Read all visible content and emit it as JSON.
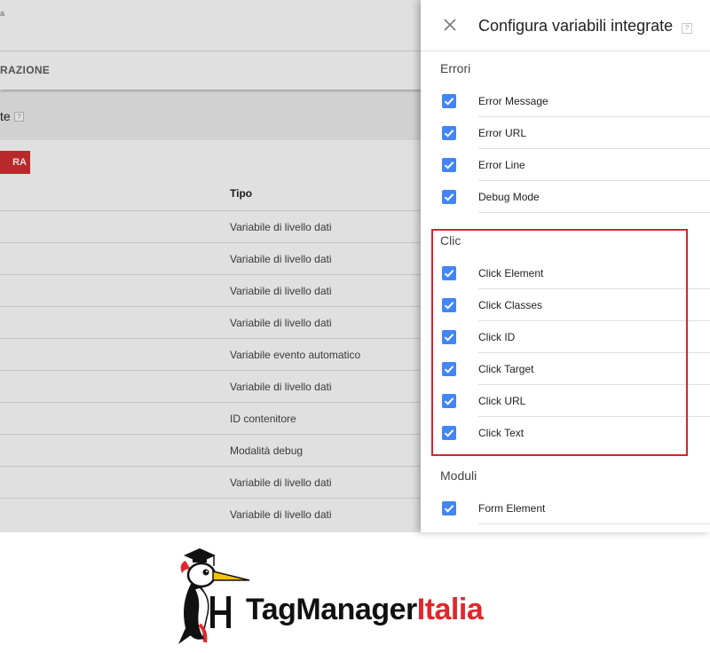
{
  "background_app": {
    "breadcrumb": "a",
    "tab_label": "RAZIONE",
    "section_title": "te",
    "section_help": "?",
    "new_button_label": "RA",
    "type_column_header": "Tipo",
    "rows": [
      {
        "type": "Variabile di livello dati"
      },
      {
        "type": "Variabile di livello dati"
      },
      {
        "type": "Variabile di livello dati"
      },
      {
        "type": "Variabile di livello dati"
      },
      {
        "type": "Variabile evento automatico"
      },
      {
        "type": "Variabile di livello dati"
      },
      {
        "type": "ID contenitore"
      },
      {
        "type": "Modalità debug"
      },
      {
        "type": "Variabile di livello dati"
      },
      {
        "type": "Variabile di livello dati"
      }
    ]
  },
  "panel": {
    "title": "Configura variabili integrate",
    "help": "?",
    "checkbox_color": "#4285f4",
    "highlight_color": "#d9232e",
    "groups": {
      "errori": {
        "title": "Errori",
        "items": [
          {
            "label": "Error Message",
            "checked": true
          },
          {
            "label": "Error URL",
            "checked": true
          },
          {
            "label": "Error Line",
            "checked": true
          },
          {
            "label": "Debug Mode",
            "checked": true
          }
        ]
      },
      "clic": {
        "title": "Clic",
        "items": [
          {
            "label": "Click Element",
            "checked": true
          },
          {
            "label": "Click Classes",
            "checked": true
          },
          {
            "label": "Click ID",
            "checked": true
          },
          {
            "label": "Click Target",
            "checked": true
          },
          {
            "label": "Click URL",
            "checked": true
          },
          {
            "label": "Click Text",
            "checked": true
          }
        ]
      },
      "moduli": {
        "title": "Moduli",
        "items": [
          {
            "label": "Form Element",
            "checked": true
          }
        ]
      }
    }
  },
  "logo": {
    "text_black": "TagManager",
    "text_red": "Italia",
    "brand_red": "#e2262b"
  }
}
